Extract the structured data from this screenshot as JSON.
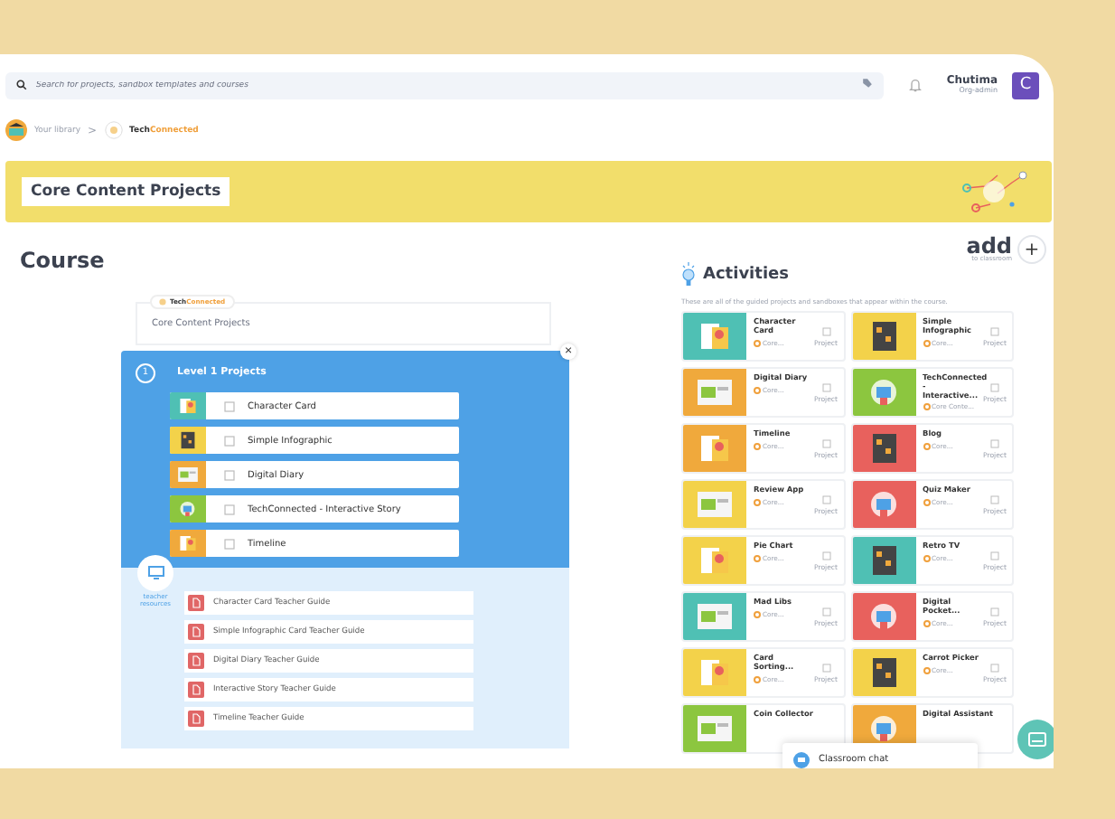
{
  "search": {
    "placeholder": "Search for projects, sandbox templates and courses"
  },
  "user": {
    "name": "Chutima",
    "role": "Org-admin",
    "initial": "C"
  },
  "breadcrumb": {
    "library": "Your library",
    "separator": ">",
    "brand_dark": "Tech",
    "brand_accent": "Connected"
  },
  "banner": {
    "title": "Core Content Projects"
  },
  "add": {
    "label": "add",
    "sublabel": "to classroom",
    "plus": "+"
  },
  "course": {
    "heading": "Course",
    "badge_dark": "Tech",
    "badge_accent": "Connected",
    "card_title": "Core Content Projects",
    "close": "×",
    "level": {
      "number": "1",
      "title": "Level 1 Projects"
    },
    "projects": [
      {
        "title": "Character Card",
        "color": "#4fc0b4"
      },
      {
        "title": "Simple Infographic",
        "color": "#f3d24a"
      },
      {
        "title": "Digital Diary",
        "color": "#f0a93c"
      },
      {
        "title": "TechConnected - Interactive Story",
        "color": "#8cc63f"
      },
      {
        "title": "Timeline",
        "color": "#f0a93c"
      }
    ],
    "resources_label": "teacher resources",
    "guides": [
      "Character Card Teacher Guide",
      "Simple Infographic Card Teacher Guide",
      "Digital Diary Teacher Guide",
      "Interactive Story Teacher Guide",
      "Timeline Teacher Guide"
    ]
  },
  "activities": {
    "title": "Activities",
    "description": "These are all of the guided projects and sandboxes that appear within the course.",
    "items": [
      {
        "title": "Character Card",
        "subtitle": "Core...",
        "tag": "Project",
        "color": "#4fc0b4"
      },
      {
        "title": "Simple Infographic",
        "subtitle": "Core...",
        "tag": "Project",
        "color": "#f3d24a"
      },
      {
        "title": "Digital Diary",
        "subtitle": "Core...",
        "tag": "Project",
        "color": "#f0a93c"
      },
      {
        "title": "TechConnected - Interactive...",
        "subtitle": "Core Conte...",
        "tag": "Project",
        "color": "#8cc63f"
      },
      {
        "title": "Timeline",
        "subtitle": "Core...",
        "tag": "Project",
        "color": "#f0a93c"
      },
      {
        "title": "Blog",
        "subtitle": "Core...",
        "tag": "Project",
        "color": "#e8615d"
      },
      {
        "title": "Review App",
        "subtitle": "Core...",
        "tag": "Project",
        "color": "#f3d24a"
      },
      {
        "title": "Quiz Maker",
        "subtitle": "Core...",
        "tag": "Project",
        "color": "#e8615d"
      },
      {
        "title": "Pie Chart",
        "subtitle": "Core...",
        "tag": "Project",
        "color": "#f3d24a"
      },
      {
        "title": "Retro TV",
        "subtitle": "Core...",
        "tag": "Project",
        "color": "#4fc0b4"
      },
      {
        "title": "Mad Libs",
        "subtitle": "Core...",
        "tag": "Project",
        "color": "#4fc0b4"
      },
      {
        "title": "Digital Pocket...",
        "subtitle": "Core...",
        "tag": "Project",
        "color": "#e8615d"
      },
      {
        "title": "Card Sorting...",
        "subtitle": "Core...",
        "tag": "Project",
        "color": "#f3d24a"
      },
      {
        "title": "Carrot Picker",
        "subtitle": "Core...",
        "tag": "Project",
        "color": "#f3d24a"
      },
      {
        "title": "Coin Collector",
        "color": "#8cc63f"
      },
      {
        "title": "Digital Assistant",
        "color": "#f0a93c"
      }
    ]
  },
  "chat": {
    "label": "Classroom chat"
  }
}
